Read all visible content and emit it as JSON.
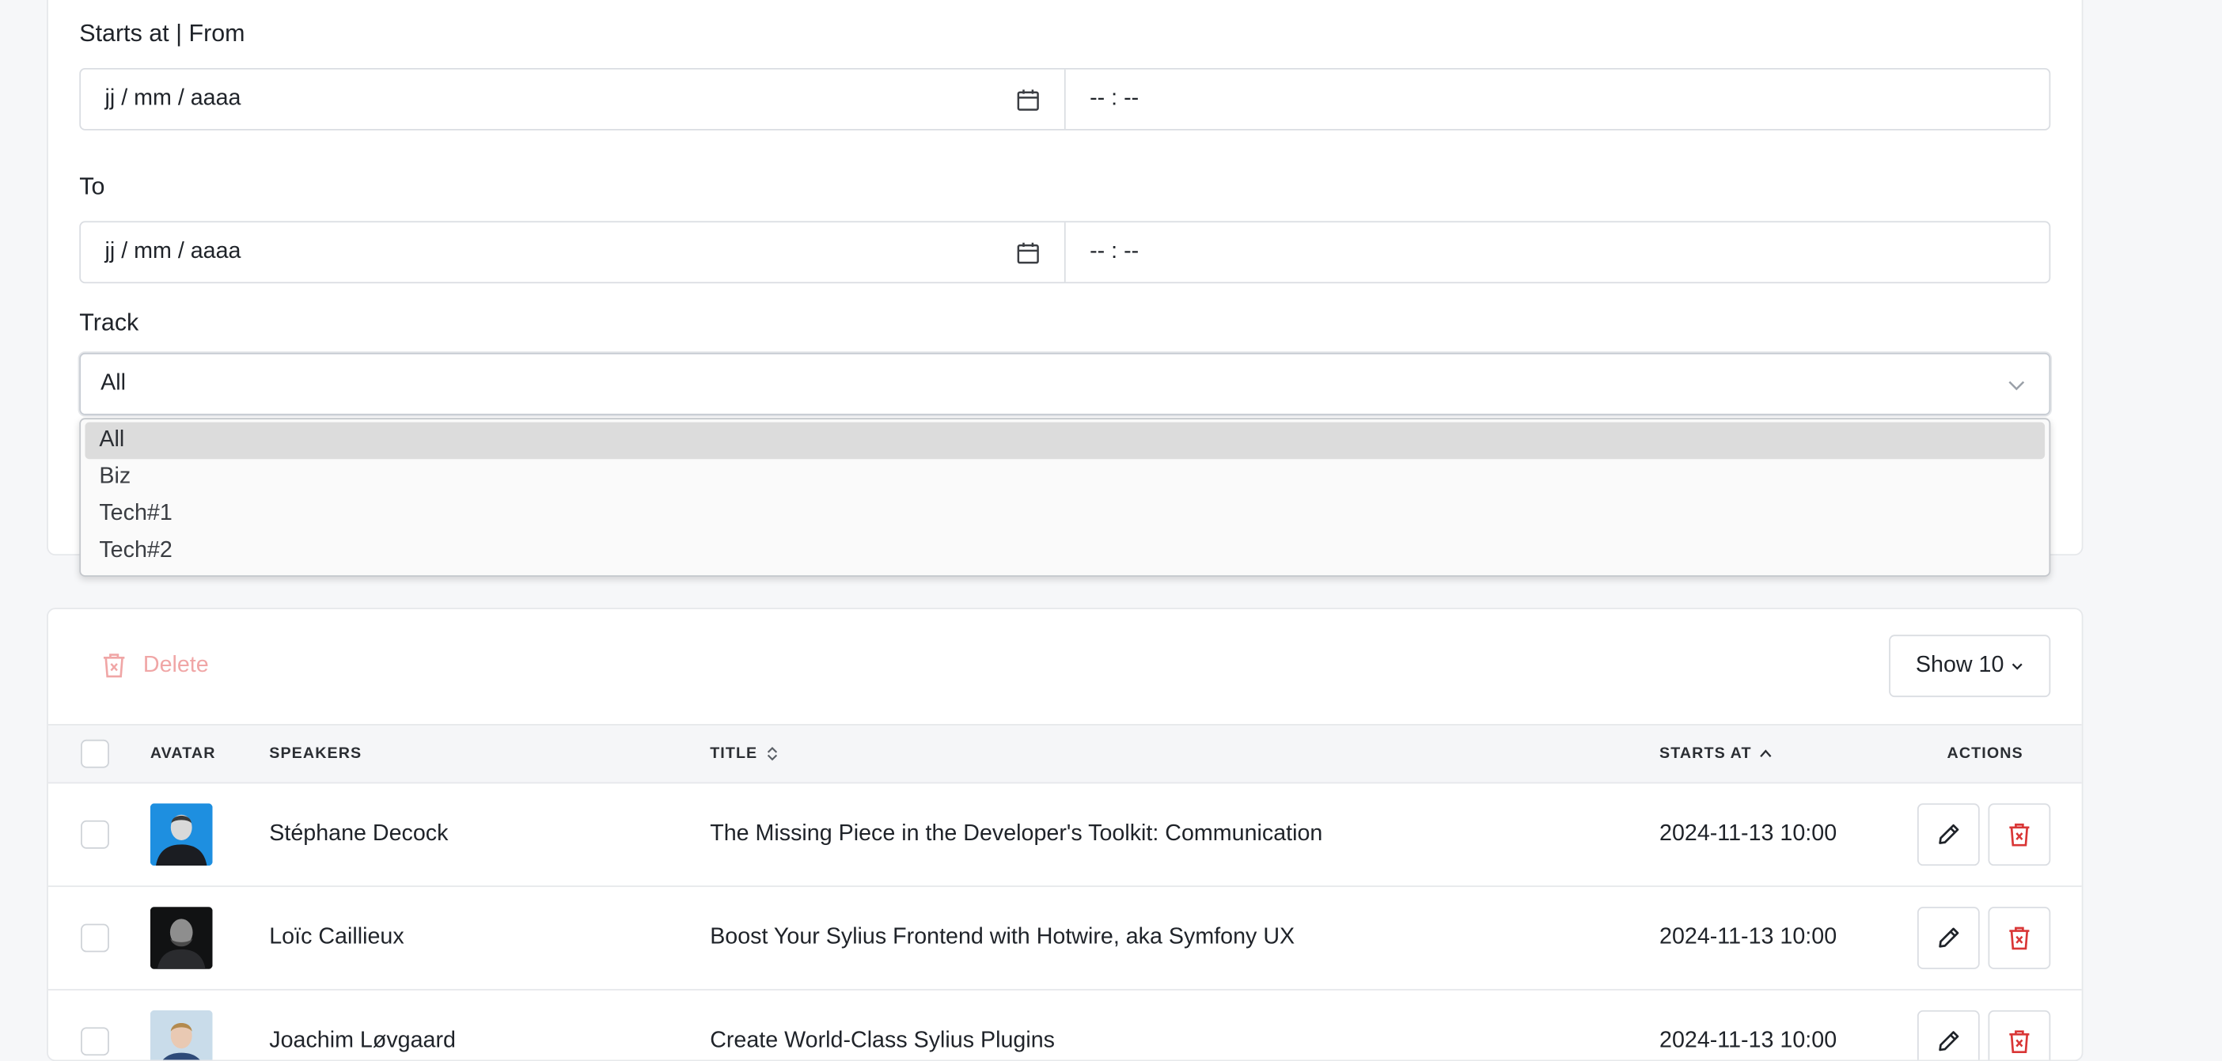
{
  "filters": {
    "starts_label": "Starts at | From",
    "from": {
      "date_placeholder": "jj / mm / aaaa",
      "time_placeholder": "-- : --"
    },
    "to_label": "To",
    "to": {
      "date_placeholder": "jj / mm / aaaa",
      "time_placeholder": "-- : --"
    },
    "track_label": "Track",
    "track_selected": "All",
    "track_options": [
      "All",
      "Biz",
      "Tech#1",
      "Tech#2"
    ]
  },
  "toolbar": {
    "delete_label": "Delete",
    "show_label": "Show 10"
  },
  "table": {
    "headers": {
      "avatar": "AVATAR",
      "speakers": "SPEAKERS",
      "title": "TITLE",
      "starts_at": "STARTS AT",
      "actions": "ACTIONS"
    },
    "rows": [
      {
        "speaker": "Stéphane Decock",
        "title": "The Missing Piece in the Developer's Toolkit: Communication",
        "starts_at": "2024-11-13 10:00"
      },
      {
        "speaker": "Loïc Caillieux",
        "title": "Boost Your Sylius Frontend with Hotwire, aka Symfony UX",
        "starts_at": "2024-11-13 10:00"
      },
      {
        "speaker": "Joachim Løvgaard",
        "title": "Create World-Class Sylius Plugins",
        "starts_at": "2024-11-13 10:00"
      }
    ]
  },
  "colors": {
    "danger": "#d93636",
    "danger_muted": "#f0a6a6",
    "option_selected_bg": "#dcdcdc"
  }
}
